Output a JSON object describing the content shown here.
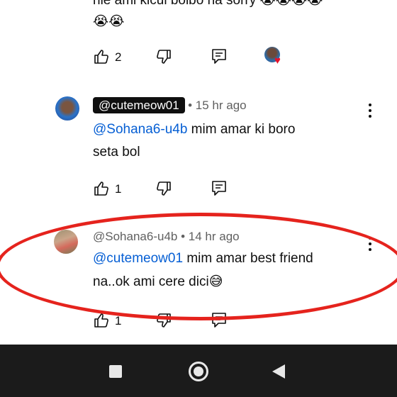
{
  "comments": [
    {
      "text_line1": "nie ami kicui bolbo na sorry",
      "emoji_line1": "😭😭😭😭",
      "emoji_line2": "😭😭",
      "likes": "2"
    },
    {
      "handle": "@cutemeow01",
      "time": "• 15 hr ago",
      "mention": "@Sohana6-u4b",
      "text_line1": "mim amar ki boro",
      "text_line2": "seta bol",
      "likes": "1"
    },
    {
      "handle": "@Sohana6-u4b",
      "time": "• 14 hr ago",
      "mention": "@cutemeow01",
      "text_line1": "mim amar best friend",
      "text_line2": "na..ok ami cere dici",
      "emoji": "😅",
      "likes": "1"
    }
  ],
  "nav": {
    "recents_icon": "square-icon",
    "home_icon": "circle-icon",
    "back_icon": "triangle-back-icon"
  },
  "colors": {
    "mention": "#065fd4",
    "annotation_oval": "#e5231d",
    "navbar": "#1b1b1b"
  }
}
